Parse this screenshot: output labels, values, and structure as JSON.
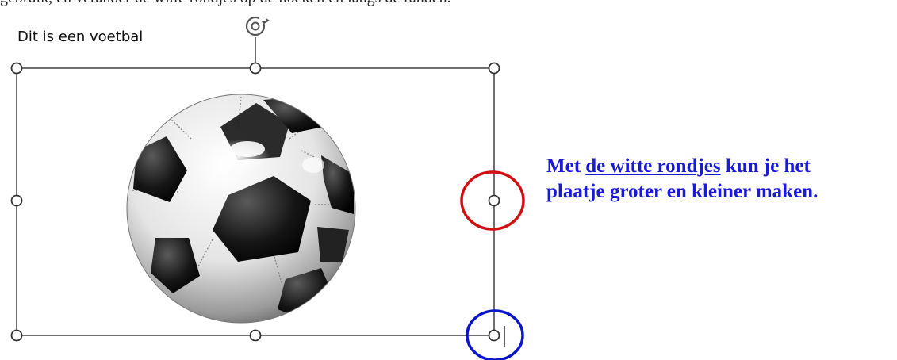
{
  "colors": {
    "instruction_text": "#1a1ad6",
    "highlight_red": "#d01010",
    "highlight_blue": "#0a14c8",
    "selection_frame": "#333333"
  },
  "document": {
    "top_partial_text": "gebruik, en verander de witte rondjes op de hoeken en langs de randen.",
    "image_caption": "Dit is een voetbal"
  },
  "image": {
    "alt": "voetbal",
    "icon": "soccer-ball"
  },
  "selection": {
    "rotate_icon": "rotate-handle-icon",
    "handles": [
      "top-left",
      "top-middle",
      "top-right",
      "middle-left",
      "middle-right",
      "bottom-left",
      "bottom-middle",
      "bottom-right"
    ]
  },
  "instruction": {
    "prefix": "Met ",
    "link": "de witte rondjes",
    "suffix_line1": " kun je het",
    "line2": "plaatje groter en kleiner maken."
  }
}
